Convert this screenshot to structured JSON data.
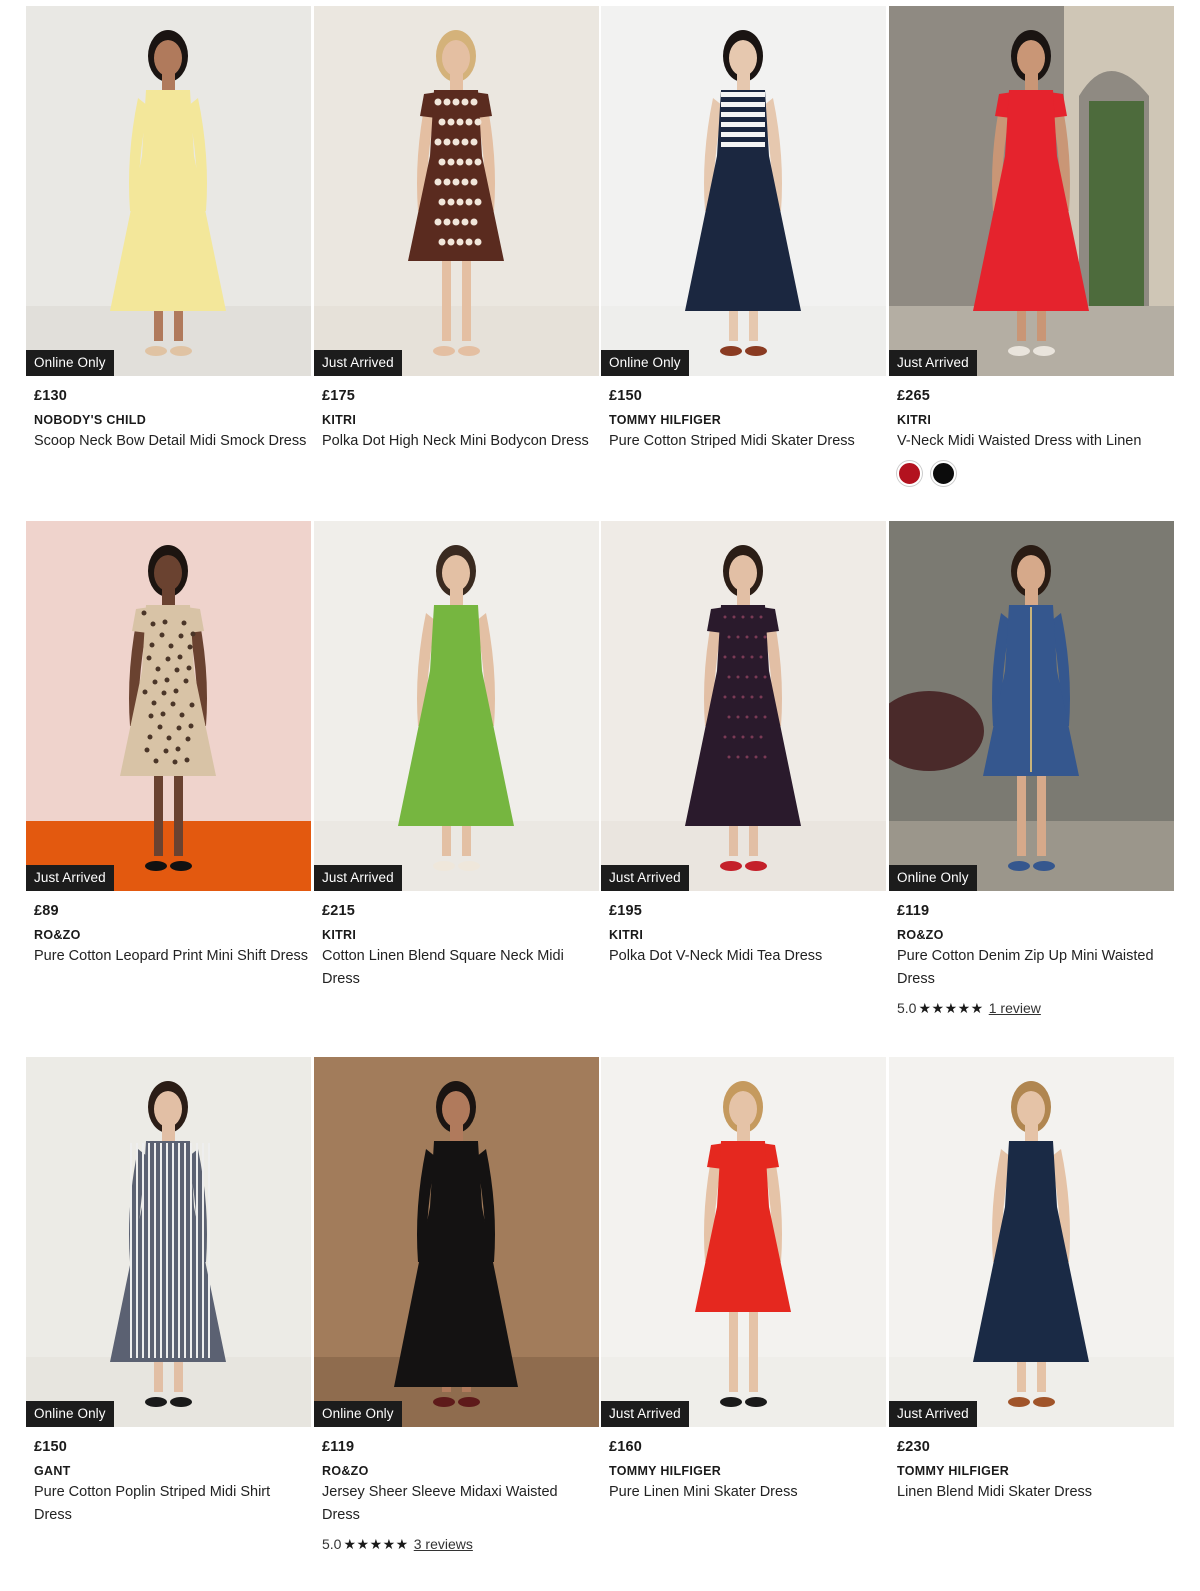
{
  "products": [
    {
      "badge": "Online Only",
      "price": "£130",
      "brand": "NOBODY'S CHILD",
      "title": "Scoop Neck Bow Detail Midi Smock Dress",
      "image": {
        "bg": "#e9e8e4",
        "floor": "#e1dfda",
        "dress": "#f3e79a",
        "skin": "#b07a5c",
        "hair": "#1a1412",
        "shoes": "#e0c3a3",
        "style": "midi-long-sleeve"
      }
    },
    {
      "badge": "Just Arrived",
      "price": "£175",
      "brand": "KITRI",
      "title": "Polka Dot High Neck Mini Bodycon Dress",
      "image": {
        "bg": "#ebe7e0",
        "floor": "#e6e1d9",
        "dress": "#5a2b1f",
        "skin": "#e4bfa2",
        "hair": "#d4b27a",
        "shoes": "#e4bfa2",
        "style": "mini-dots"
      }
    },
    {
      "badge": "Online Only",
      "price": "£150",
      "brand": "TOMMY HILFIGER",
      "title": "Pure Cotton Striped Midi Skater Dress",
      "image": {
        "bg": "#f2f2f1",
        "floor": "#eeeeec",
        "dress": "#1b2740",
        "skin": "#e6c8af",
        "hair": "#1a1412",
        "shoes": "#8a3b22",
        "style": "midi-stripe-top"
      }
    },
    {
      "badge": "Just Arrived",
      "price": "£265",
      "brand": "KITRI",
      "title": "V-Neck Midi Waisted Dress with Linen",
      "swatches": [
        "#b3121f",
        "#0c0c0c"
      ],
      "image": {
        "bg": "#8f8a82",
        "floor": "#b4aea3",
        "dress": "#e5232d",
        "skin": "#c99676",
        "hair": "#1a1412",
        "shoes": "#e9e4dc",
        "style": "midi-outdoor"
      }
    },
    {
      "badge": "Just Arrived",
      "price": "£89",
      "brand": "RO&ZO",
      "title": "Pure Cotton Leopard Print Mini Shift Dress",
      "image": {
        "bg": "#efd3cc",
        "floor": "#e3590f",
        "dress": "#d8c3a6",
        "skin": "#6a4230",
        "hair": "#1c1410",
        "shoes": "#111111",
        "style": "mini-leopard"
      }
    },
    {
      "badge": "Just Arrived",
      "price": "£215",
      "brand": "KITRI",
      "title": "Cotton Linen Blend Square Neck Midi Dress",
      "image": {
        "bg": "#f0eeea",
        "floor": "#ebe8e3",
        "dress": "#76b640",
        "skin": "#e3c0a4",
        "hair": "#3a2a20",
        "shoes": "#efe7db",
        "style": "midi-strappy"
      }
    },
    {
      "badge": "Just Arrived",
      "price": "£195",
      "brand": "KITRI",
      "title": "Polka Dot V-Neck Midi Tea Dress",
      "image": {
        "bg": "#efebe6",
        "floor": "#eae5df",
        "dress": "#2a1a2c",
        "skin": "#e2bfa5",
        "hair": "#2b1d16",
        "shoes": "#c4202a",
        "style": "midi-vneck"
      }
    },
    {
      "badge": "Online Only",
      "price": "£119",
      "brand": "RO&ZO",
      "title": "Pure Cotton Denim Zip Up Mini Waisted Dress",
      "rating": {
        "score": "5.0",
        "stars": "★★★★★",
        "reviews": "1 review"
      },
      "image": {
        "bg": "#7b7a72",
        "floor": "#9b968b",
        "dress": "#35578e",
        "skin": "#d6a98a",
        "hair": "#2a1c14",
        "shoes": "#35578e",
        "style": "mini-denim"
      }
    },
    {
      "badge": "Online Only",
      "price": "£150",
      "brand": "GANT",
      "title": "Pure Cotton Poplin Striped Midi Shirt Dress",
      "image": {
        "bg": "#ecebe6",
        "floor": "#e7e5df",
        "dress": "#5b6172",
        "skin": "#e2bfa5",
        "hair": "#2b1d16",
        "shoes": "#1a1a1a",
        "style": "midi-shirt"
      }
    },
    {
      "badge": "Online Only",
      "price": "£119",
      "brand": "RO&ZO",
      "title": "Jersey Sheer Sleeve Midaxi Waisted Dress",
      "rating": {
        "score": "5.0",
        "stars": "★★★★★",
        "reviews": "3 reviews"
      },
      "image": {
        "bg": "#a27c5b",
        "floor": "#8f6c4e",
        "dress": "#141212",
        "skin": "#b07a5c",
        "hair": "#1a1412",
        "shoes": "#5e1a1a",
        "style": "maxi-long-sleeve"
      }
    },
    {
      "badge": "Just Arrived",
      "price": "£160",
      "brand": "TOMMY HILFIGER",
      "title": "Pure Linen Mini Skater Dress",
      "image": {
        "bg": "#f3f2ef",
        "floor": "#efeeea",
        "dress": "#e5281f",
        "skin": "#e5c3a7",
        "hair": "#c59a5e",
        "shoes": "#1a1a1a",
        "style": "mini-red"
      }
    },
    {
      "badge": "Just Arrived",
      "price": "£230",
      "brand": "TOMMY HILFIGER",
      "title": "Linen Blend Midi Skater Dress",
      "image": {
        "bg": "#f3f2ef",
        "floor": "#efeeea",
        "dress": "#1a2a45",
        "skin": "#e5c3a7",
        "hair": "#b08650",
        "shoes": "#a0542a",
        "style": "midi-sleeveless"
      }
    }
  ]
}
